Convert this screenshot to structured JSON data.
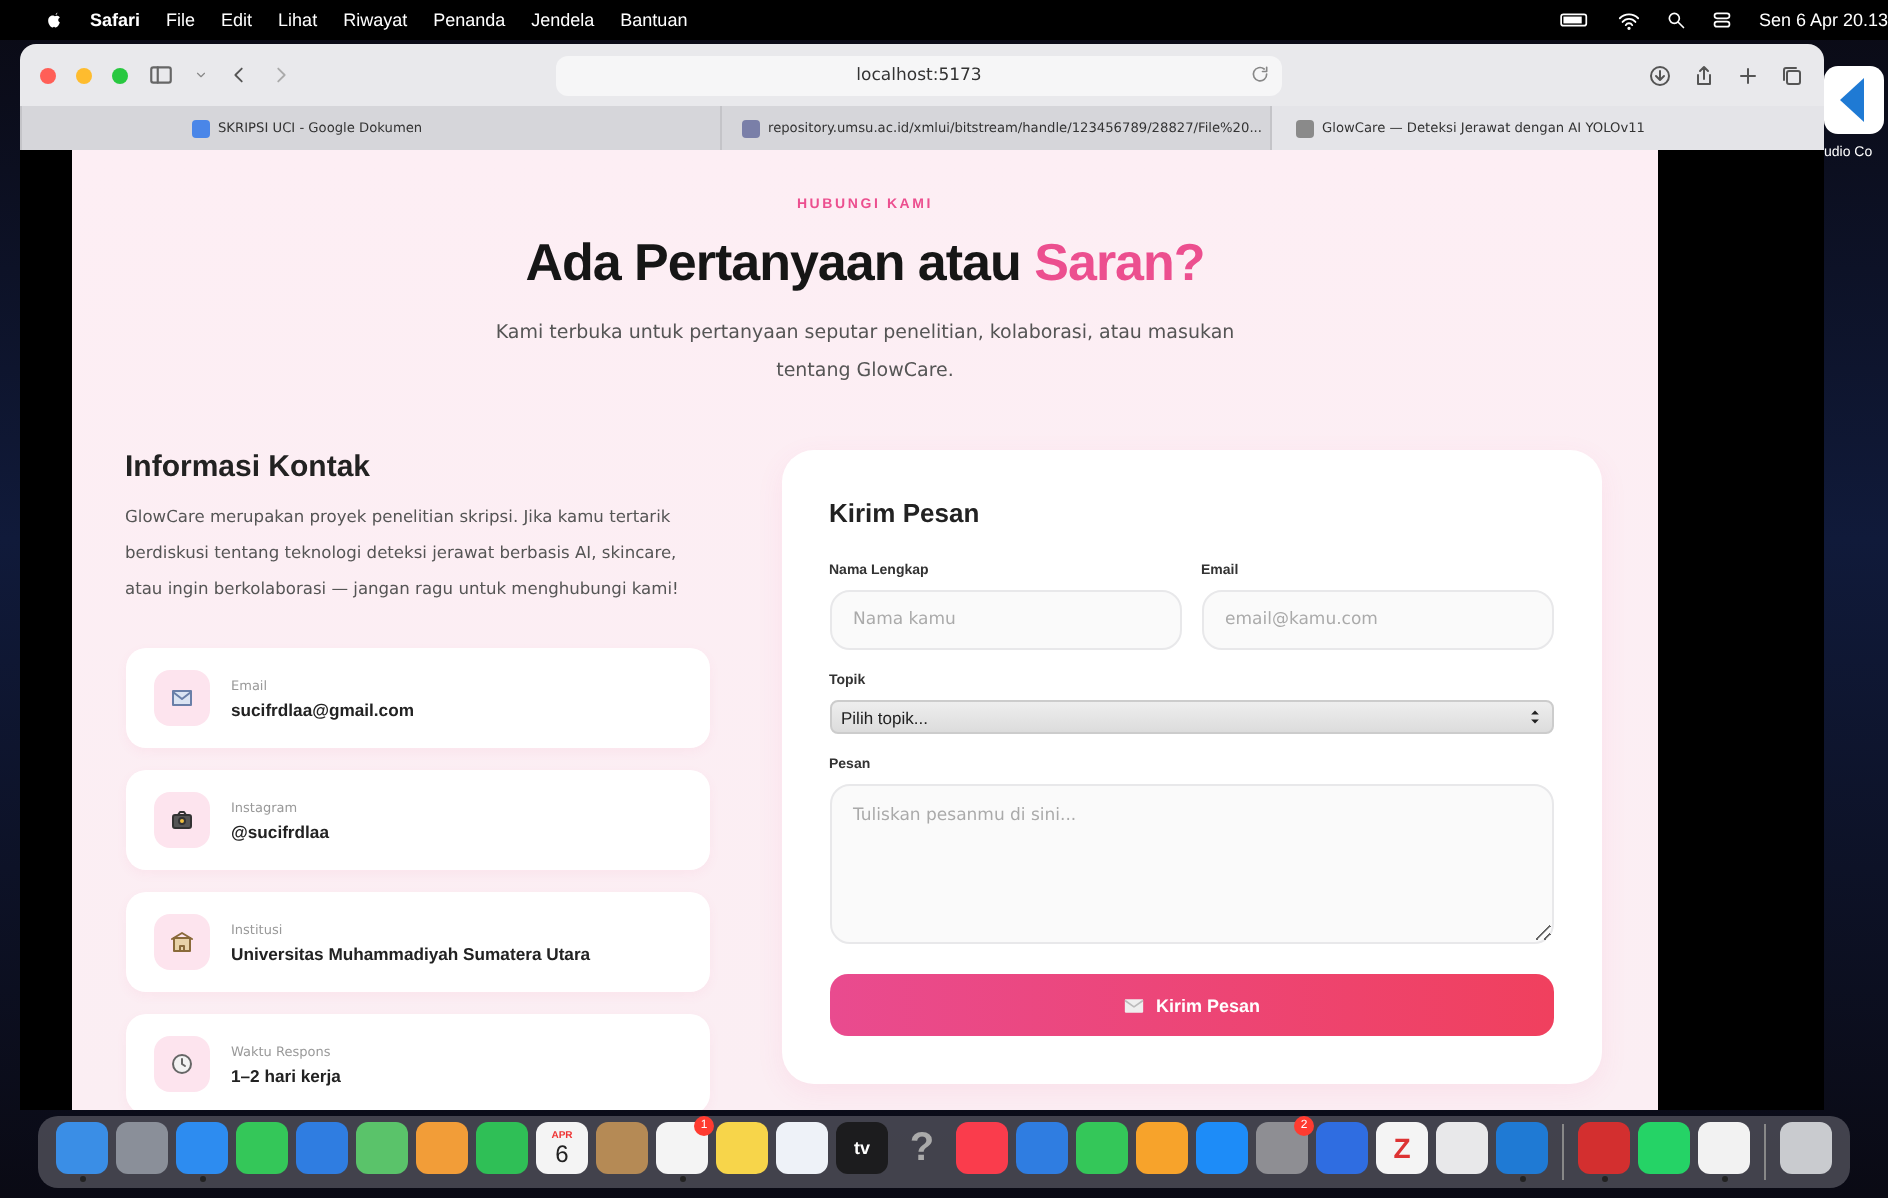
{
  "menu_bar": {
    "app": "Safari",
    "menus": [
      "File",
      "Edit",
      "Lihat",
      "Riwayat",
      "Penanda",
      "Jendela",
      "Bantuan"
    ],
    "clock": "Sen 6 Apr 20.13"
  },
  "desktop": {
    "app_label": "udio Co"
  },
  "browser": {
    "address": "localhost:5173",
    "tabs": [
      {
        "title": "SKRIPSI UCI - Google Dokumen",
        "color": "#4a86e8",
        "selected": false
      },
      {
        "title": "repository.umsu.ac.id/xmlui/bitstream/handle/123456789/28827/File%20...",
        "color": "#7a7fa8",
        "selected": false
      },
      {
        "title": "GlowCare — Deteksi Jerawat dengan AI YOLOv11",
        "color": "#8a8a8a",
        "selected": true
      }
    ]
  },
  "page": {
    "eyebrow": "HUBUNGI KAMI",
    "heading": "Ada Pertanyaan atau",
    "heading_accent": "Saran?",
    "subtitle": "Kami terbuka untuk pertanyaan seputar penelitian, kolaborasi, atau masukan tentang GlowCare.",
    "info": {
      "title": "Informasi Kontak",
      "text": "GlowCare merupakan proyek penelitian skripsi. Jika kamu tertarik berdiskusi tentang teknologi deteksi jerawat berbasis AI, skincare, atau ingin berkolaborasi — jangan ragu untuk menghubungi kami!",
      "contacts": [
        {
          "kind": "email",
          "label": "Email",
          "value": "sucifrdlaa@gmail.com"
        },
        {
          "kind": "camera",
          "label": "Instagram",
          "value": "@sucifrdlaa"
        },
        {
          "kind": "building",
          "label": "Institusi",
          "value": "Universitas Muhammadiyah Sumatera Utara"
        },
        {
          "kind": "clock",
          "label": "Waktu Respons",
          "value": "1–2 hari kerja"
        }
      ]
    },
    "form": {
      "title": "Kirim Pesan",
      "name_label": "Nama Lengkap",
      "name_placeholder": "Nama kamu",
      "email_label": "Email",
      "email_placeholder": "email@kamu.com",
      "topic_label": "Topik",
      "topic_value": "Pilih topik...",
      "message_label": "Pesan",
      "message_placeholder": "Tuliskan pesanmu di sini...",
      "submit": "Kirim Pesan"
    }
  },
  "dock": {
    "items": [
      {
        "kind": "app",
        "color": "#3a8ee6",
        "running": true
      },
      {
        "kind": "app",
        "color": "#8a8f99",
        "running": false
      },
      {
        "kind": "app",
        "color": "#2d8cf0",
        "running": true
      },
      {
        "kind": "app",
        "color": "#34c759",
        "running": false
      },
      {
        "kind": "app",
        "color": "#2f7de1",
        "running": false
      },
      {
        "kind": "app",
        "color": "#5ac36a",
        "running": false
      },
      {
        "kind": "app",
        "color": "#f29d38",
        "running": false
      },
      {
        "kind": "app",
        "color": "#2fbf56",
        "running": false
      },
      {
        "kind": "calendar",
        "color": "#f4f4f4",
        "month": "APR",
        "day": "6",
        "running": false
      },
      {
        "kind": "app",
        "color": "#b58a55",
        "running": false
      },
      {
        "kind": "app",
        "color": "#f4f4f4",
        "badge": "1",
        "running": true
      },
      {
        "kind": "app",
        "color": "#f7d54a",
        "running": false
      },
      {
        "kind": "app",
        "color": "#eef2f8",
        "running": false
      },
      {
        "kind": "label",
        "color": "#1c1c1e",
        "label": "tv",
        "running": false
      },
      {
        "kind": "glyph",
        "label": "?",
        "running": false
      },
      {
        "kind": "app",
        "color": "#fa3c4c",
        "running": false
      },
      {
        "kind": "app",
        "color": "#2f7de1",
        "running": false
      },
      {
        "kind": "app",
        "color": "#34c759",
        "running": false
      },
      {
        "kind": "app",
        "color": "#f7a32b",
        "running": false
      },
      {
        "kind": "app",
        "color": "#1d8cf8",
        "running": false
      },
      {
        "kind": "app",
        "color": "#8e8e93",
        "badge": "2",
        "running": false
      },
      {
        "kind": "app",
        "color": "#2f6de1",
        "running": false
      },
      {
        "kind": "label",
        "color": "#f4f4f4",
        "label": "Z",
        "running": false
      },
      {
        "kind": "app",
        "color": "#e8e8ea",
        "running": false
      },
      {
        "kind": "app",
        "color": "#1f7ad4",
        "running": true
      },
      {
        "kind": "separator"
      },
      {
        "kind": "app",
        "color": "#d32f2f",
        "running": true
      },
      {
        "kind": "app",
        "color": "#25d366",
        "running": false
      },
      {
        "kind": "app",
        "color": "#f2f2f2",
        "running": true
      },
      {
        "kind": "separator"
      },
      {
        "kind": "app",
        "color": "#c9cbcf",
        "running": false
      }
    ]
  }
}
